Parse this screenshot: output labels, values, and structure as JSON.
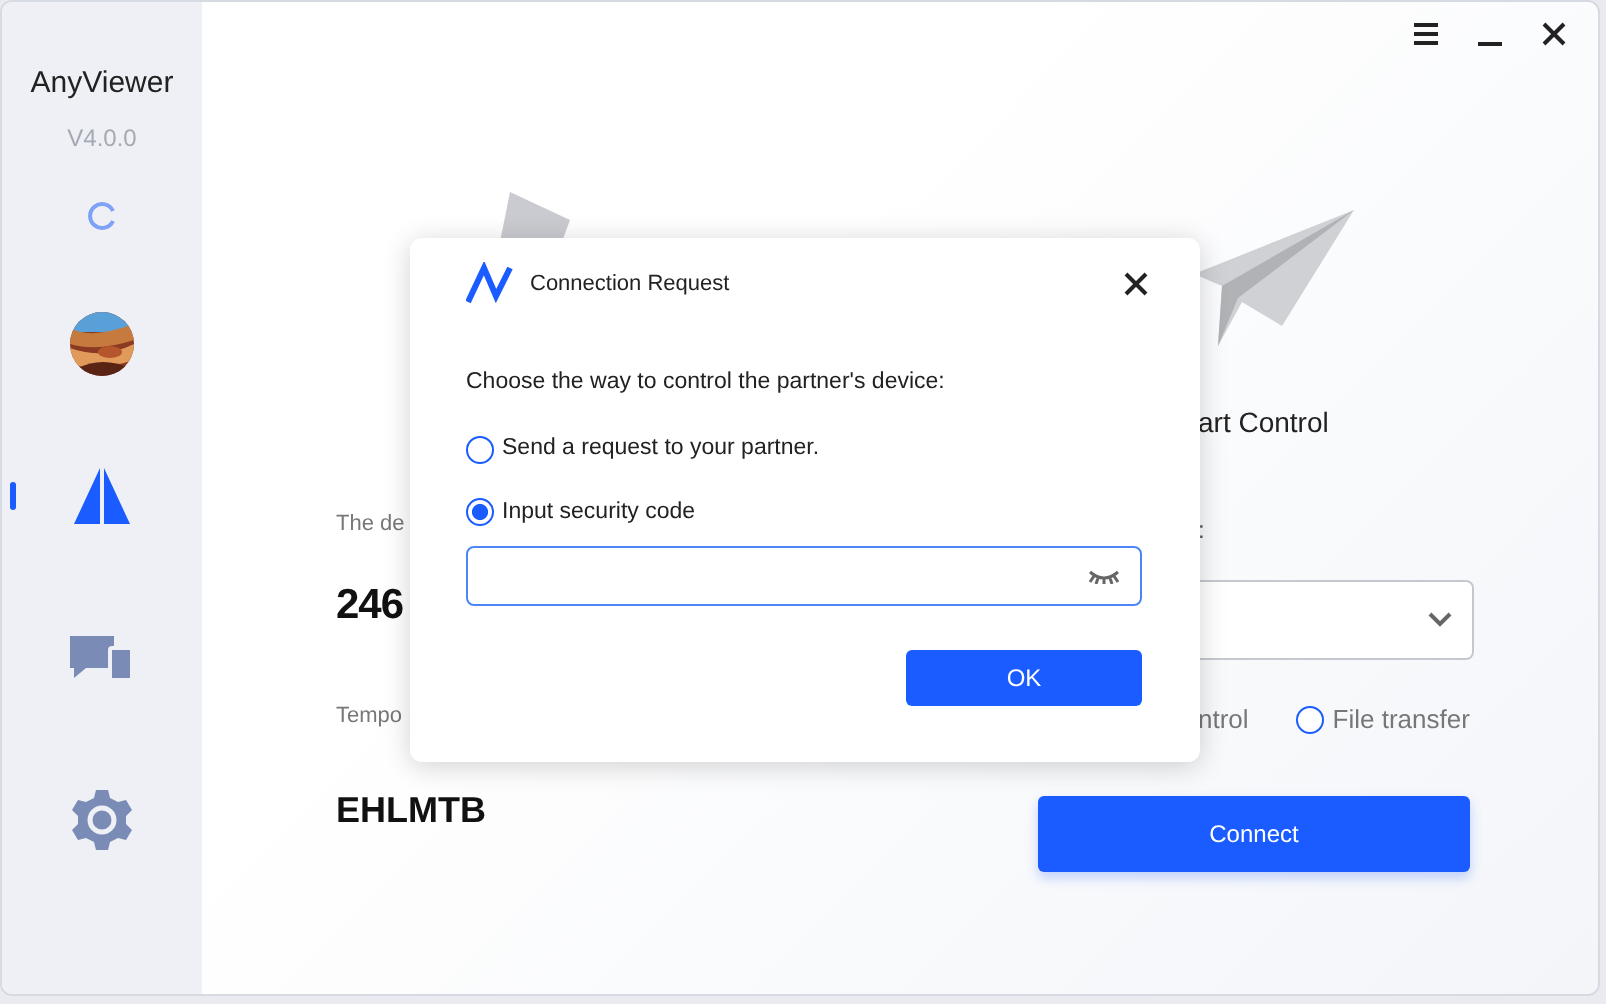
{
  "app": {
    "name": "AnyViewer",
    "version": "V4.0.0"
  },
  "sidebar": {
    "items": [
      {
        "kind": "loading",
        "selected": false
      },
      {
        "kind": "avatar",
        "selected": false
      },
      {
        "kind": "connect",
        "selected": true
      },
      {
        "kind": "devices",
        "selected": false
      },
      {
        "kind": "settings",
        "selected": false
      }
    ]
  },
  "left_panel": {
    "device_id_label": "The de",
    "device_id": "246",
    "temp_code_label": "Tempo",
    "temp_code": "EHLMTB"
  },
  "right_panel": {
    "title": "art Control",
    "partner_label": ":",
    "mode_partial": "ntrol",
    "file_transfer": {
      "label": "File transfer",
      "selected": false
    },
    "button": "Connect"
  },
  "dialog": {
    "title": "Connection Request",
    "prompt": "Choose the way to control the partner's device:",
    "options": [
      {
        "label": "Send a request to your partner.",
        "selected": false
      },
      {
        "label": "Input security code",
        "selected": true
      }
    ],
    "ok": "OK"
  }
}
